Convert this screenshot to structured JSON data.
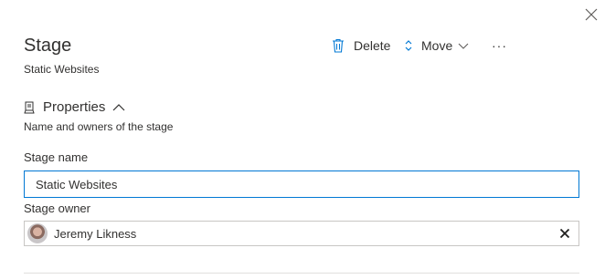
{
  "header": {
    "title": "Stage",
    "subtitle": "Static Websites"
  },
  "toolbar": {
    "delete_label": "Delete",
    "move_label": "Move",
    "more_label": "···"
  },
  "properties": {
    "title": "Properties",
    "description": "Name and owners of the stage",
    "stage_name_label": "Stage name",
    "stage_name_value": "Static Websites",
    "stage_owner_label": "Stage owner",
    "owner_name": "Jeremy Likness"
  },
  "colors": {
    "accent": "#0078d4",
    "text": "#323130",
    "border": "#c8c6c4"
  },
  "icons": {
    "close": "close-icon",
    "delete": "trash-icon",
    "move": "move-icon",
    "move_caret": "chevron-down-icon",
    "section": "properties-icon",
    "collapse": "chevron-up-icon"
  }
}
